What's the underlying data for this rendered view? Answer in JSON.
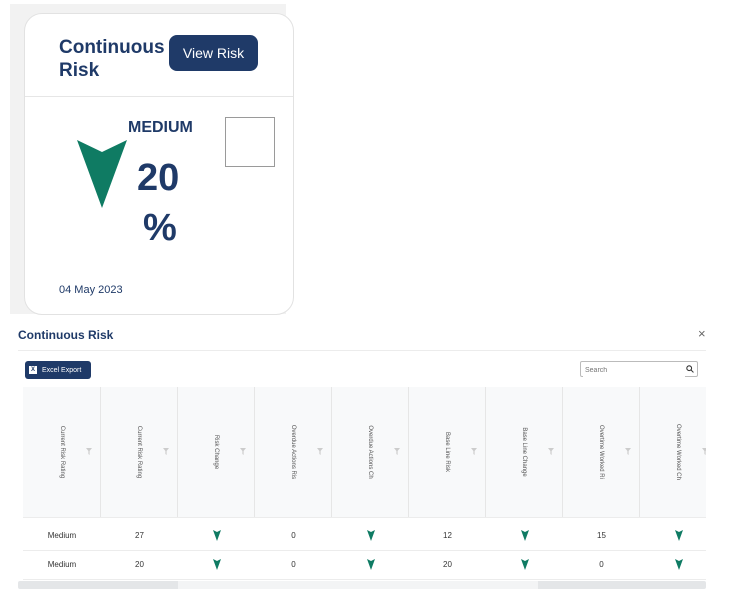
{
  "card": {
    "title": "Continuous Risk",
    "view_button": "View Risk",
    "rating": "MEDIUM",
    "percent_value": "20",
    "percent_sign": "%",
    "date": "04 May 2023",
    "arrow_icon": "down-arrow-icon",
    "arrow_color": "#0f7b63"
  },
  "modal": {
    "title": "Continuous Risk",
    "close": "×",
    "excel_export": "Excel Export",
    "search_placeholder": "Search",
    "columns": [
      "Current Risk Rating",
      "Current Risk Rating",
      "Risk Change",
      "Overdue Actions Ris",
      "Overdue Actions Ch",
      "Base Line Risk",
      "Base Line Change",
      "Overtime Worked Ri",
      "Overtime Worked Ch"
    ],
    "rows": [
      [
        "Medium",
        "27",
        "down",
        "0",
        "down",
        "12",
        "down",
        "15",
        "down"
      ],
      [
        "Medium",
        "20",
        "down",
        "0",
        "down",
        "20",
        "down",
        "0",
        "down"
      ]
    ]
  },
  "colors": {
    "primary": "#1f3a68",
    "arrow": "#0f7b63"
  }
}
